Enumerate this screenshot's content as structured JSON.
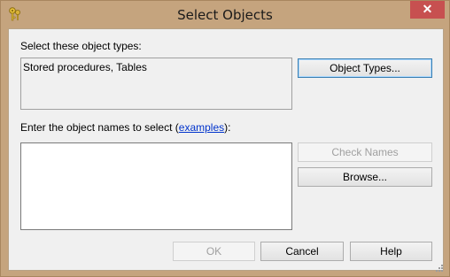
{
  "window": {
    "title": "Select Objects",
    "close_glyph": "✕",
    "icon": "key-icon"
  },
  "object_types": {
    "label": "Select these object types:",
    "value": "Stored procedures, Tables",
    "button": "Object Types..."
  },
  "object_names": {
    "label_prefix": "Enter the object names to select (",
    "label_link": "examples",
    "label_suffix": "):",
    "value": "",
    "check_names_button": "Check Names",
    "browse_button": "Browse..."
  },
  "footer": {
    "ok_button": "OK",
    "cancel_button": "Cancel",
    "help_button": "Help"
  },
  "colors": {
    "frame": "#c5a47e",
    "close_button": "#c75050",
    "link": "#0033cc"
  }
}
